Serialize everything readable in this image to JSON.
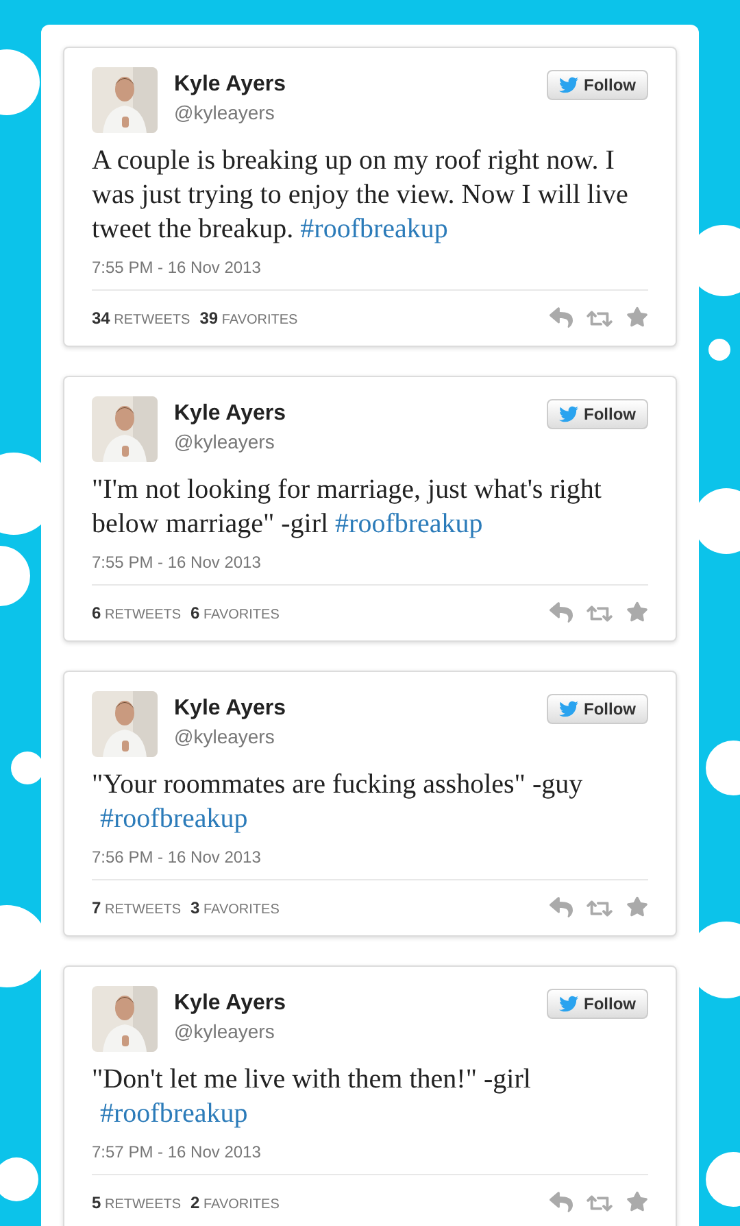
{
  "tweets": [
    {
      "name": "Kyle Ayers",
      "handle": "@kyleayers",
      "follow": "Follow",
      "text": "A couple is breaking up on my roof right now. I was just trying to enjoy the view. Now I will live tweet the breakup.",
      "hashtag": "#roofbreakup",
      "hashtag_own_line": false,
      "time": "7:55 PM - 16 Nov 2013",
      "retweets": "34",
      "retweets_label": "RETWEETS",
      "favorites": "39",
      "favorites_label": "FAVORITES"
    },
    {
      "name": "Kyle Ayers",
      "handle": "@kyleayers",
      "follow": "Follow",
      "text": "\"I'm not looking for marriage, just what's right below marriage\" -girl",
      "hashtag": "#roofbreakup",
      "hashtag_own_line": false,
      "time": "7:55 PM - 16 Nov 2013",
      "retweets": "6",
      "retweets_label": "RETWEETS",
      "favorites": "6",
      "favorites_label": "FAVORITES"
    },
    {
      "name": "Kyle Ayers",
      "handle": "@kyleayers",
      "follow": "Follow",
      "text": "\"Your roommates are fucking assholes\" -guy",
      "hashtag": "#roofbreakup",
      "hashtag_own_line": true,
      "time": "7:56 PM - 16 Nov 2013",
      "retweets": "7",
      "retweets_label": "RETWEETS",
      "favorites": "3",
      "favorites_label": "FAVORITES"
    },
    {
      "name": "Kyle Ayers",
      "handle": "@kyleayers",
      "follow": "Follow",
      "text": "\"Don't let me live with them then!\" -girl",
      "hashtag": "#roofbreakup",
      "hashtag_own_line": true,
      "time": "7:57 PM - 16 Nov 2013",
      "retweets": "5",
      "retweets_label": "RETWEETS",
      "favorites": "2",
      "favorites_label": "FAVORITES"
    }
  ]
}
